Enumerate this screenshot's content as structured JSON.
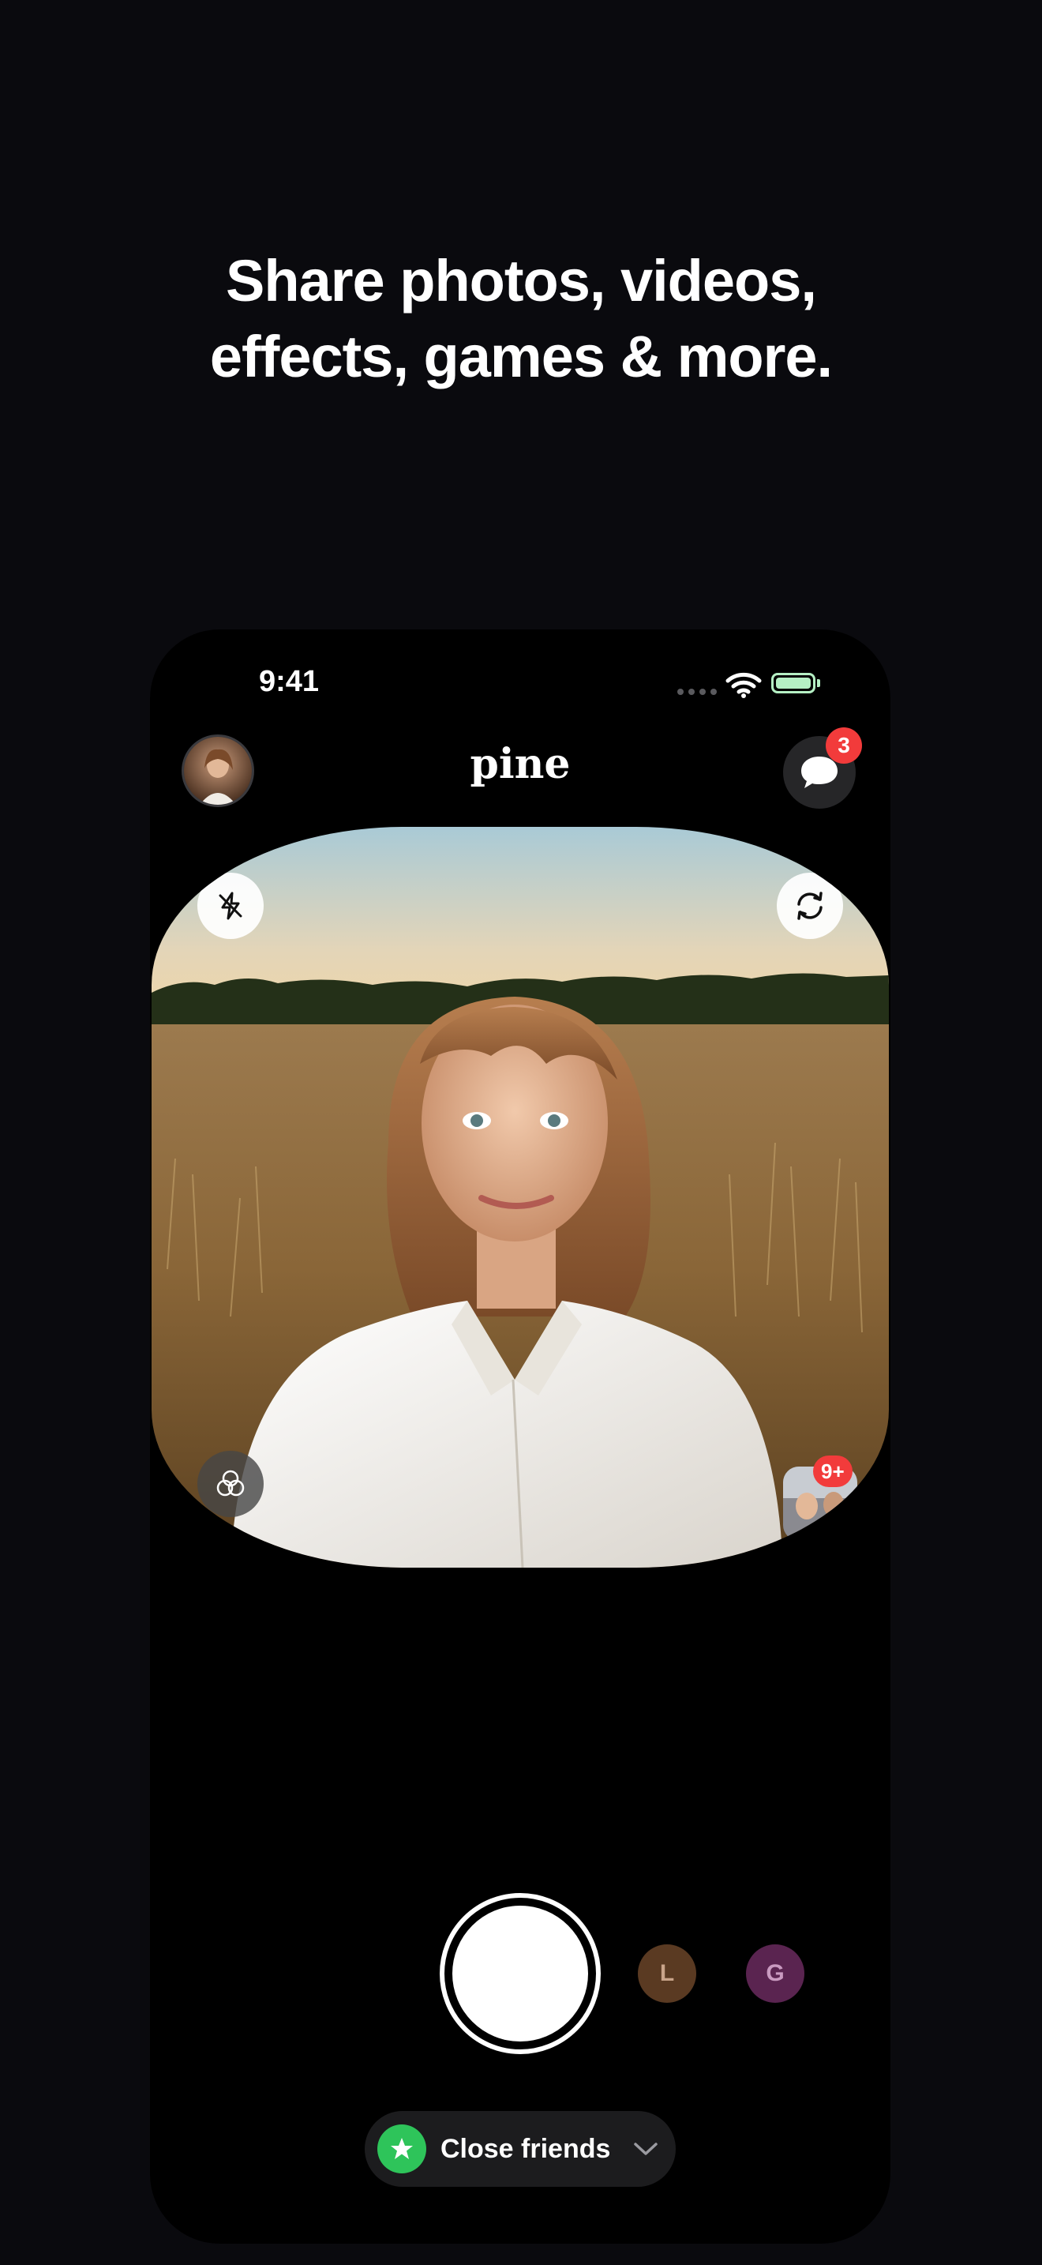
{
  "headline": {
    "line1": "Share photos, videos,",
    "line2": "effects, games & more."
  },
  "status_bar": {
    "time": "9:41"
  },
  "app": {
    "title": "pine"
  },
  "header": {
    "messages_badge": "3"
  },
  "camera": {
    "gallery_badge": "9+"
  },
  "friends": [
    {
      "initial": "L",
      "color": "#5a3a22"
    },
    {
      "initial": "G",
      "color": "#5a2450"
    }
  ],
  "audience": {
    "label": "Close friends"
  },
  "colors": {
    "background": "#0a0a0e",
    "badge": "#f23b3b",
    "close_friends_green": "#2ec45a"
  }
}
